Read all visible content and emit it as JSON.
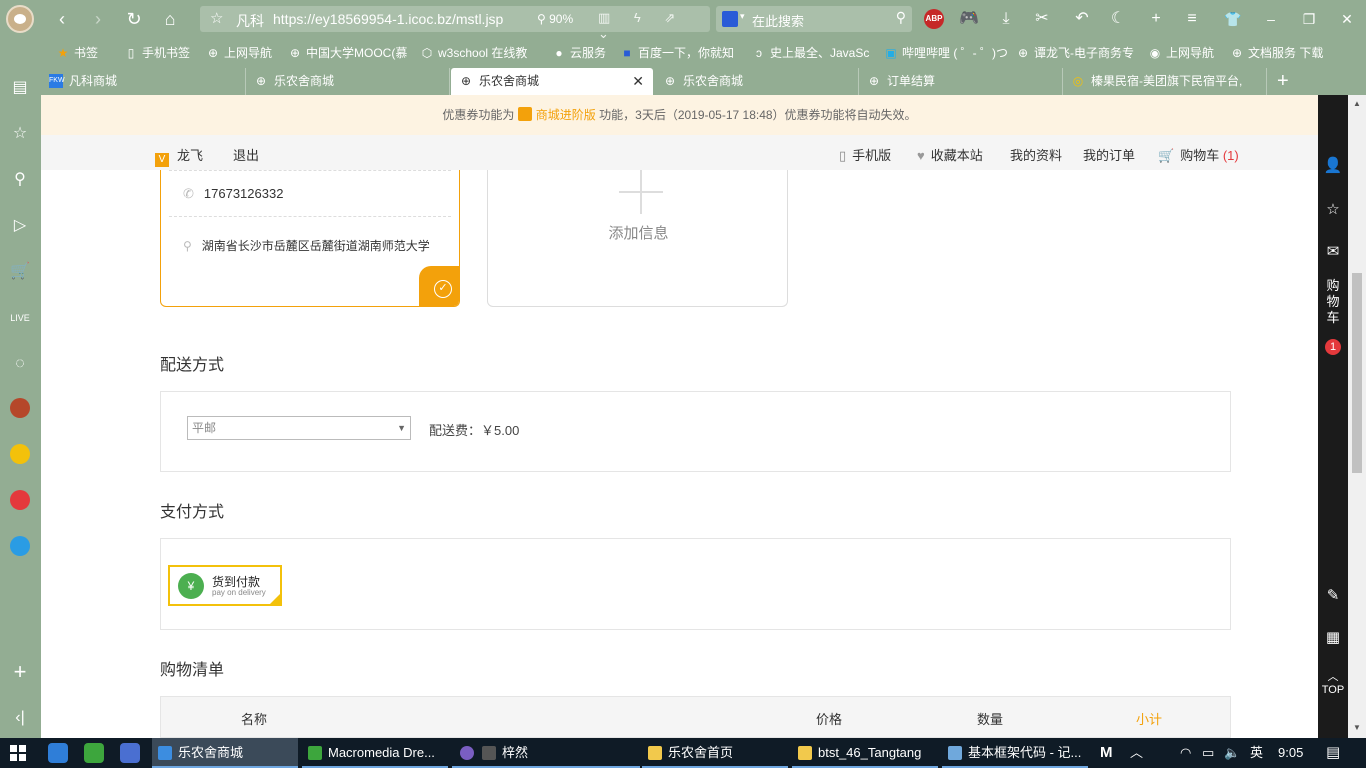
{
  "browser": {
    "site_name": "凡科",
    "url": "https://ey18569954-1.icoc.bz/mstl.jsp",
    "zoom": "90%",
    "search_placeholder": "在此搜索",
    "abp_label": "ABP"
  },
  "bookmarks": [
    {
      "label": "书签",
      "icon": "star-icon"
    },
    {
      "label": "手机书签",
      "icon": "phone-icon"
    },
    {
      "label": "上网导航",
      "icon": "globe-icon"
    },
    {
      "label": "中国大学MOOC(慕",
      "icon": "globe-icon"
    },
    {
      "label": "w3school 在线教",
      "icon": "w3-icon"
    },
    {
      "label": "云服务",
      "icon": "cloud-icon"
    },
    {
      "label": "百度一下，你就知",
      "icon": "baidu-icon"
    },
    {
      "label": "史上最全、JavaSc",
      "icon": "code-icon"
    },
    {
      "label": "哔哩哔哩 ( ゜- ゜)つ",
      "icon": "bilibili-icon"
    },
    {
      "label": "谭龙飞-电子商务专",
      "icon": "globe-icon"
    },
    {
      "label": "上网导航",
      "icon": "search-icon"
    },
    {
      "label": "文档服务 下载",
      "icon": "globe-icon"
    }
  ],
  "tabs": [
    {
      "label": "凡科商城",
      "icon": "fkw-icon"
    },
    {
      "label": "乐农舍商城",
      "icon": "globe-icon"
    },
    {
      "label": "乐农舍商城",
      "icon": "globe-icon",
      "active": true
    },
    {
      "label": "乐农舍商城",
      "icon": "globe-icon"
    },
    {
      "label": "订单结算",
      "icon": "globe-icon"
    },
    {
      "label": "榛果民宿-美团旗下民宿平台,",
      "icon": "hazelnut-icon"
    }
  ],
  "notice": {
    "before": "优惠券功能为",
    "highlight": "商城进阶版",
    "after": "功能，3天后（2019-05-17 18:48）优惠券功能将自动失效。"
  },
  "topnav": {
    "user_badge": "V",
    "username": "龙飞",
    "logout": "退出",
    "mobile": "手机版",
    "favorite": "收藏本站",
    "profile": "我的资料",
    "orders": "我的订单",
    "cart": "购物车",
    "cart_count": "(1)"
  },
  "address": {
    "phone": "17673126332",
    "location": "湖南省长沙市岳麓区岳麓街道湖南师范大学"
  },
  "add_info": "添加信息",
  "shipping": {
    "title": "配送方式",
    "selected": "平邮",
    "fee_label": "配送费：",
    "fee_value": "￥5.00"
  },
  "payment": {
    "title": "支付方式",
    "option_cn": "货到付款",
    "option_en": "pay on delivery"
  },
  "cart_list": {
    "title": "购物清单",
    "columns": [
      "名称",
      "价格",
      "数量",
      "小计"
    ]
  },
  "right_sidebar": {
    "cart_label": [
      "购",
      "物",
      "车"
    ],
    "cart_badge": "1",
    "top_label": "TOP"
  },
  "taskbar": {
    "tasks": [
      {
        "label": "乐农舍商城",
        "active": true,
        "color": "#3c8de0"
      },
      {
        "label": "Macromedia Dre...",
        "color": "#3da63d"
      },
      {
        "label": "梓然",
        "color": "#7a5ec2"
      },
      {
        "label": "乐农舍首页",
        "color": "#f2c94c"
      },
      {
        "label": "btst_46_Tangtang",
        "color": "#f2c94c"
      },
      {
        "label": "基本框架代码 - 记...",
        "color": "#6fa8dc"
      }
    ],
    "ime": "英",
    "time": "9:05"
  },
  "colors": {
    "accent": "#f3a10b",
    "chrome": "#93ad93",
    "cart_red": "#e4393c"
  }
}
